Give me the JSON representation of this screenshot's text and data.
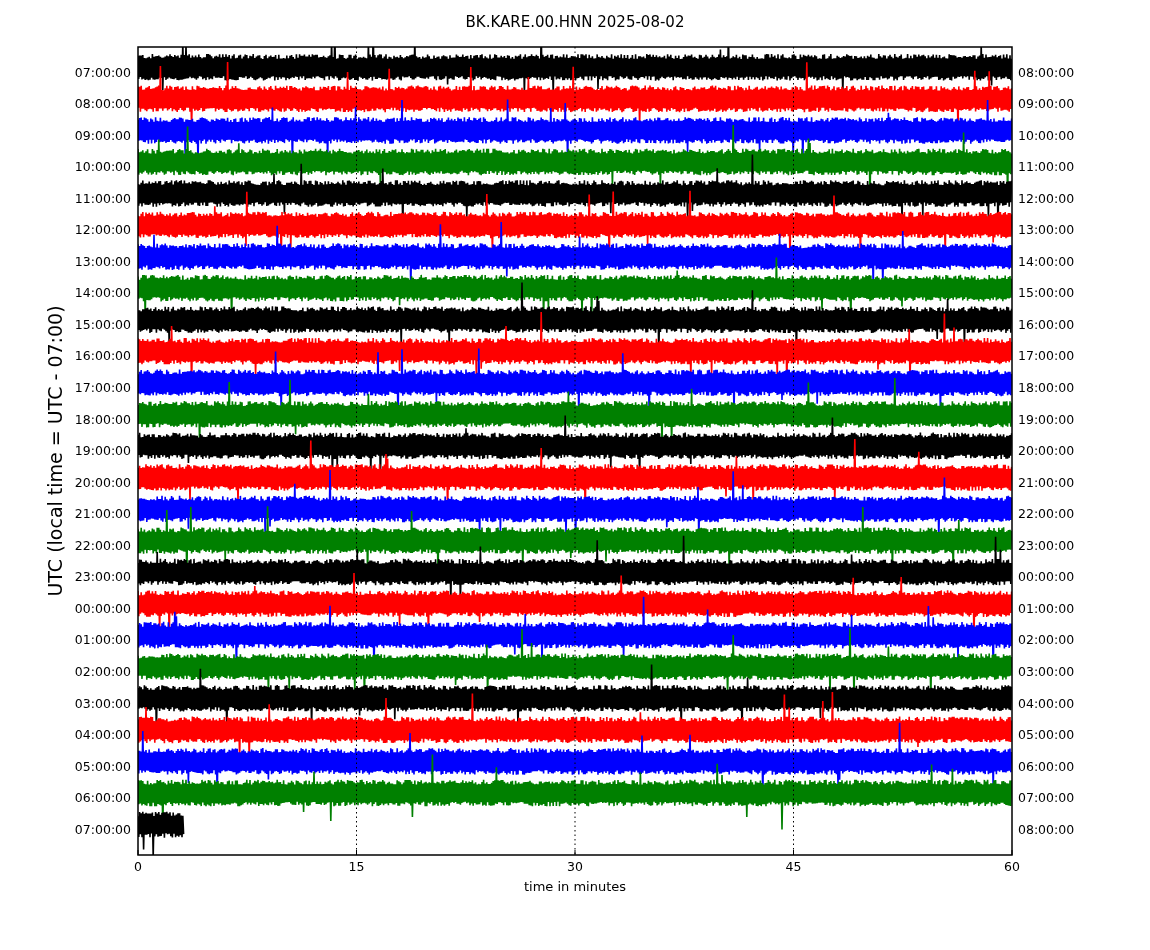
{
  "title": "BK.KARE.00.HNN 2025-08-02",
  "ylabel": "UTC (local time = UTC - 07:00)",
  "xlabel": "time in minutes",
  "x_ticks": [
    "0",
    "15",
    "30",
    "45",
    "60"
  ],
  "rows": [
    {
      "left_label": "07:00:00",
      "right_label": "08:00:00",
      "color": "#000000",
      "kind": "full"
    },
    {
      "left_label": "08:00:00",
      "right_label": "09:00:00",
      "color": "#ff0000",
      "kind": "full"
    },
    {
      "left_label": "09:00:00",
      "right_label": "10:00:00",
      "color": "#0000ff",
      "kind": "full"
    },
    {
      "left_label": "10:00:00",
      "right_label": "11:00:00",
      "color": "#008000",
      "kind": "full"
    },
    {
      "left_label": "11:00:00",
      "right_label": "12:00:00",
      "color": "#000000",
      "kind": "full"
    },
    {
      "left_label": "12:00:00",
      "right_label": "13:00:00",
      "color": "#ff0000",
      "kind": "full"
    },
    {
      "left_label": "13:00:00",
      "right_label": "14:00:00",
      "color": "#0000ff",
      "kind": "full"
    },
    {
      "left_label": "14:00:00",
      "right_label": "15:00:00",
      "color": "#008000",
      "kind": "full"
    },
    {
      "left_label": "15:00:00",
      "right_label": "16:00:00",
      "color": "#000000",
      "kind": "full"
    },
    {
      "left_label": "16:00:00",
      "right_label": "17:00:00",
      "color": "#ff0000",
      "kind": "full"
    },
    {
      "left_label": "17:00:00",
      "right_label": "18:00:00",
      "color": "#0000ff",
      "kind": "full"
    },
    {
      "left_label": "18:00:00",
      "right_label": "19:00:00",
      "color": "#008000",
      "kind": "full"
    },
    {
      "left_label": "19:00:00",
      "right_label": "20:00:00",
      "color": "#000000",
      "kind": "full"
    },
    {
      "left_label": "20:00:00",
      "right_label": "21:00:00",
      "color": "#ff0000",
      "kind": "full"
    },
    {
      "left_label": "21:00:00",
      "right_label": "22:00:00",
      "color": "#0000ff",
      "kind": "full"
    },
    {
      "left_label": "22:00:00",
      "right_label": "23:00:00",
      "color": "#008000",
      "kind": "full"
    },
    {
      "left_label": "23:00:00",
      "right_label": "00:00:00",
      "color": "#000000",
      "kind": "full"
    },
    {
      "left_label": "00:00:00",
      "right_label": "01:00:00",
      "color": "#ff0000",
      "kind": "full"
    },
    {
      "left_label": "01:00:00",
      "right_label": "02:00:00",
      "color": "#0000ff",
      "kind": "full"
    },
    {
      "left_label": "02:00:00",
      "right_label": "03:00:00",
      "color": "#008000",
      "kind": "full"
    },
    {
      "left_label": "03:00:00",
      "right_label": "04:00:00",
      "color": "#000000",
      "kind": "full"
    },
    {
      "left_label": "04:00:00",
      "right_label": "05:00:00",
      "color": "#ff0000",
      "kind": "full"
    },
    {
      "left_label": "05:00:00",
      "right_label": "06:00:00",
      "color": "#0000ff",
      "kind": "full"
    },
    {
      "left_label": "06:00:00",
      "right_label": "07:00:00",
      "color": "#008000",
      "kind": "full"
    },
    {
      "left_label": "07:00:00",
      "right_label": "08:00:00",
      "color": "#000000",
      "kind": "partial"
    }
  ]
}
